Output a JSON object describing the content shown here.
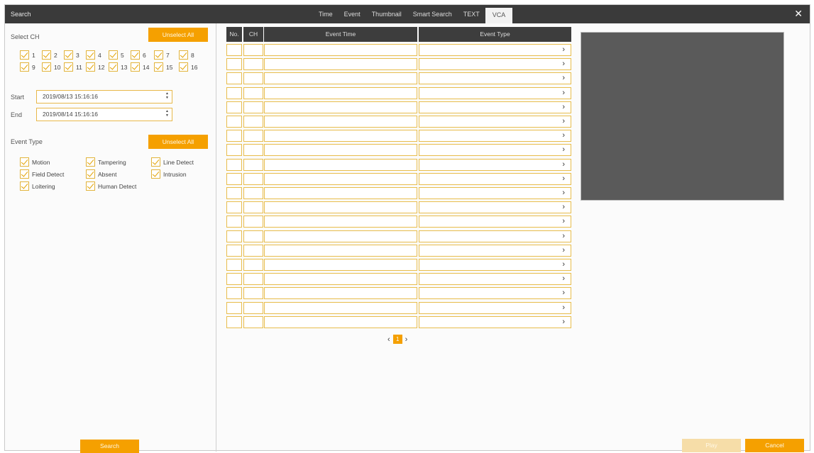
{
  "window": {
    "title": "Search",
    "close_glyph": "✕"
  },
  "tabs": [
    {
      "label": "Time",
      "active": false
    },
    {
      "label": "Event",
      "active": false
    },
    {
      "label": "Thumbnail",
      "active": false
    },
    {
      "label": "Smart Search",
      "active": false
    },
    {
      "label": "TEXT",
      "active": false
    },
    {
      "label": "VCA",
      "active": true
    }
  ],
  "channels": {
    "label": "Select CH",
    "unselect_label": "Unselect All",
    "items": [
      "1",
      "2",
      "3",
      "4",
      "5",
      "6",
      "7",
      "8",
      "9",
      "10",
      "11",
      "12",
      "13",
      "14",
      "15",
      "16"
    ]
  },
  "time_range": {
    "start_label": "Start",
    "start_value": "2019/08/13 15:16:16",
    "end_label": "End",
    "end_value": "2019/08/14 15:16:16"
  },
  "event_type": {
    "label": "Event Type",
    "unselect_label": "Unselect All",
    "items": [
      "Motion",
      "Tampering",
      "Line Detect",
      "Field Detect",
      "Absent",
      "Intrusion",
      "Loitering",
      "Human Detect"
    ]
  },
  "search_label": "Search",
  "table": {
    "headers": {
      "no": "No.",
      "ch": "CH",
      "time": "Event Time",
      "type": "Event Type"
    },
    "row_count": 20,
    "chevron": "›"
  },
  "pagination": {
    "prev": "‹",
    "current": "1",
    "next": "›"
  },
  "footer": {
    "play_label": "Play",
    "cancel_label": "Cancel"
  },
  "colors": {
    "accent": "#f5a000",
    "titlebar": "#3a3a3a",
    "preview": "#5a5a5a"
  }
}
